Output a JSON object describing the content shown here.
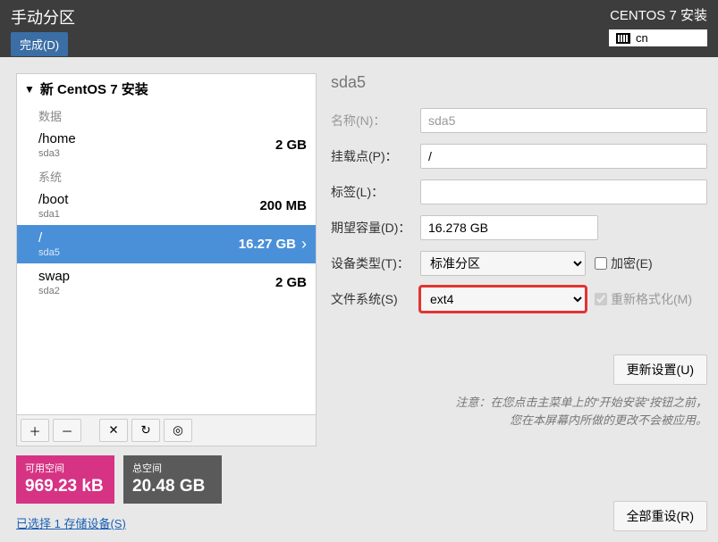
{
  "topbar": {
    "title": "手动分区",
    "done": "完成(D)",
    "installer": "CENTOS 7 安装",
    "keyboard": "cn"
  },
  "tree": {
    "header": "新 CentOS 7 安装",
    "sections": {
      "data": "数据",
      "system": "系统"
    },
    "items": [
      {
        "mount": "/home",
        "dev": "sda3",
        "size": "2 GB",
        "section": "data"
      },
      {
        "mount": "/boot",
        "dev": "sda1",
        "size": "200 MB",
        "section": "system"
      },
      {
        "mount": "/",
        "dev": "sda5",
        "size": "16.27 GB",
        "section": "system",
        "selected": true
      },
      {
        "mount": "swap",
        "dev": "sda2",
        "size": "2 GB",
        "section": "system"
      }
    ]
  },
  "space": {
    "avail_label": "可用空间",
    "avail_value": "969.23 kB",
    "total_label": "总空间",
    "total_value": "20.48 GB"
  },
  "storage_link": "已选择 1 存储设备(S)",
  "detail": {
    "title": "sda5",
    "labels": {
      "name": "名称(N)：",
      "mount": "挂载点(P)：",
      "label": "标签(L)：",
      "capacity": "期望容量(D)：",
      "devtype": "设备类型(T)：",
      "encrypt": "加密(E)",
      "fs": "文件系统(S)",
      "reformat": "重新格式化(M)"
    },
    "values": {
      "name": "sda5",
      "mount": "/",
      "label": "",
      "capacity": "16.278 GB",
      "devtype": "标准分区",
      "fs": "ext4"
    },
    "update_btn": "更新设置(U)",
    "note_l1": "注意：在您点击主菜单上的“开始安装“按钮之前，",
    "note_l2": "您在本屏幕内所做的更改不会被应用。"
  },
  "reset_btn": "全部重设(R)"
}
